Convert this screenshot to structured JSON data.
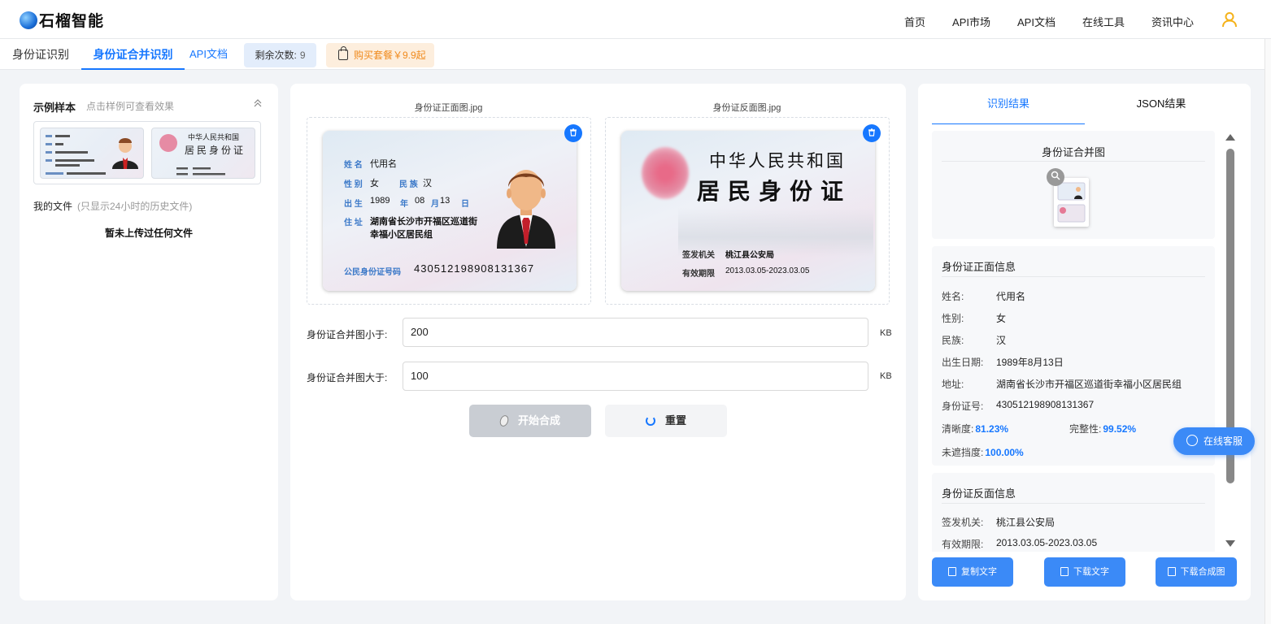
{
  "brand": {
    "name": "石榴智能"
  },
  "topnav": [
    "首页",
    "API市场",
    "API文档",
    "在线工具",
    "资讯中心"
  ],
  "subnav": {
    "tab_id": "身份证识别",
    "tab_merge": "身份证合并识别",
    "api_link": "API文档",
    "remain_label": "剩余次数:",
    "remain_value": "9",
    "buy_label": "购买套餐￥9.9起"
  },
  "left": {
    "sample_title": "示例样本",
    "sample_hint": "点击样例可查看效果",
    "files_title": "我的文件",
    "files_hint": "(只显示24小时的历史文件)",
    "no_files": "暂未上传过任何文件"
  },
  "center": {
    "front_name": "身份证正面图.jpg",
    "back_name": "身份证反面图.jpg",
    "front": {
      "name_label": "姓 名",
      "name": "代用名",
      "sex_label": "性 别",
      "sex": "女",
      "nation_label": "民 族",
      "nation": "汉",
      "birth_label": "出 生",
      "birth_year": "1989",
      "year": "年",
      "birth_month": "08",
      "month": "月",
      "birth_day": "13",
      "day": "日",
      "addr_label": "住 址",
      "addr1": "湖南省长沙市开福区巡道街",
      "addr2": "幸福小区居民组",
      "id_label": "公民身份证号码",
      "id": "430512198908131367"
    },
    "back": {
      "title": "中华人民共和国",
      "big": "居民身份证",
      "authority_label": "签发机关",
      "authority": "桃江县公安局",
      "valid_label": "有效期限",
      "valid": "2013.03.05-2023.03.05"
    },
    "max_label": "身份证合并图小于:",
    "max_value": "200",
    "min_label": "身份证合并图大于:",
    "min_value": "100",
    "unit": "KB",
    "start_button": "开始合成",
    "reset_button": "重置"
  },
  "right": {
    "tab_result": "识别结果",
    "tab_json": "JSON结果",
    "merge_title": "身份证合并图",
    "front_title": "身份证正面信息",
    "front_fields": [
      {
        "k": "姓名:",
        "v": "代用名"
      },
      {
        "k": "性别:",
        "v": "女"
      },
      {
        "k": "民族:",
        "v": "汉"
      },
      {
        "k": "出生日期:",
        "v": "1989年8月13日"
      },
      {
        "k": "地址:",
        "v": "湖南省长沙市开福区巡道街幸福小区居民组"
      },
      {
        "k": "身份证号:",
        "v": "430512198908131367"
      }
    ],
    "clarity_label": "清晰度:",
    "clarity": "81.23%",
    "integrity_label": "完整性:",
    "integrity": "99.52%",
    "unblocked_label": "未遮挡度:",
    "unblocked": "100.00%",
    "back_title": "身份证反面信息",
    "back_fields": [
      {
        "k": "签发机关:",
        "v": "桃江县公安局"
      },
      {
        "k": "有效期限:",
        "v": "2013.03.05-2023.03.05"
      }
    ],
    "copy_button": "复制文字",
    "download_text_button": "下载文字",
    "download_image_button": "下载合成图"
  },
  "service": "在线客服",
  "colors": {
    "accent": "#1677ff",
    "button": "#3b8af7",
    "buy": "#f08a1c"
  }
}
